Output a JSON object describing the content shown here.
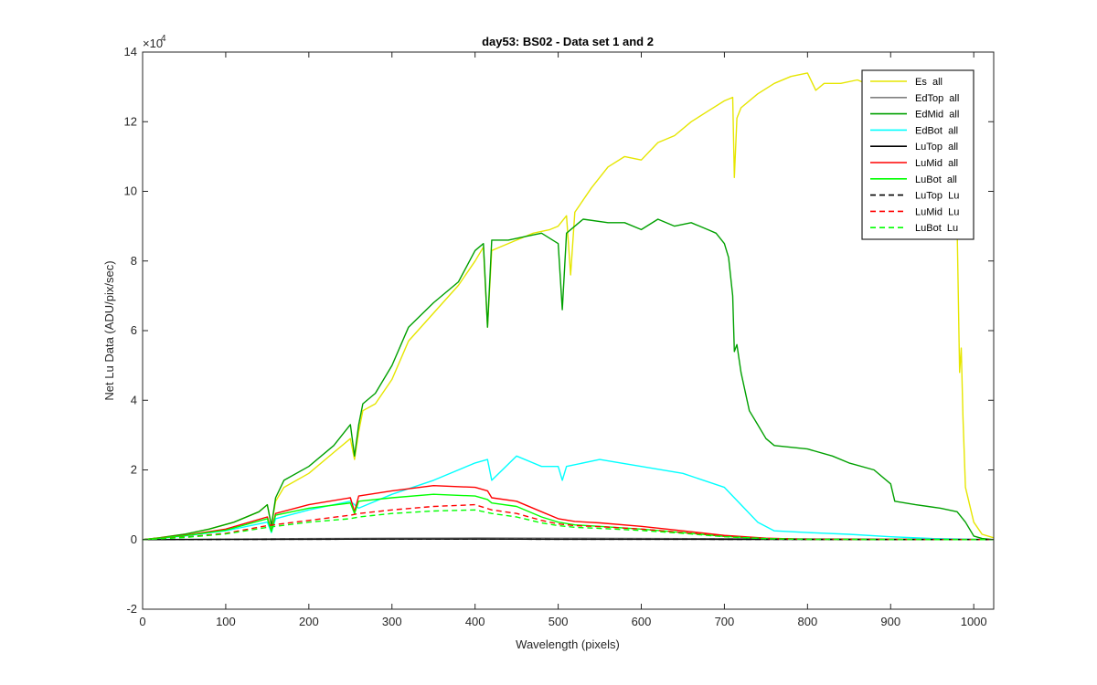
{
  "chart_data": {
    "type": "line",
    "title": "day53: BS02 - Data set 1 and 2",
    "xlabel": "Wavelength (pixels)",
    "ylabel": "Net Lu Data (ADU/pix/sec)",
    "xlim": [
      0,
      1024
    ],
    "ylim": [
      -20000,
      140000
    ],
    "y_exponent_label": "×10",
    "y_exponent_power": "4",
    "xticks": [
      0,
      100,
      200,
      300,
      400,
      500,
      600,
      700,
      800,
      900,
      1000
    ],
    "xtick_labels": [
      "0",
      "100",
      "200",
      "300",
      "400",
      "500",
      "600",
      "700",
      "800",
      "900",
      "1000"
    ],
    "yticks": [
      -20000,
      0,
      20000,
      40000,
      60000,
      80000,
      100000,
      120000,
      140000
    ],
    "ytick_labels": [
      "-2",
      "0",
      "2",
      "4",
      "6",
      "8",
      "10",
      "12",
      "14"
    ],
    "grid": false,
    "legend_position": "top-right",
    "series": [
      {
        "name": "Es  all",
        "color": "#e6e600",
        "dash": "solid",
        "x": [
          0,
          20,
          50,
          80,
          110,
          140,
          150,
          155,
          160,
          170,
          200,
          230,
          250,
          255,
          260,
          265,
          280,
          300,
          320,
          350,
          380,
          400,
          410,
          415,
          420,
          430,
          450,
          470,
          490,
          500,
          510,
          515,
          520,
          540,
          560,
          580,
          600,
          620,
          640,
          660,
          680,
          700,
          710,
          712,
          715,
          720,
          740,
          760,
          780,
          800,
          810,
          820,
          840,
          860,
          880,
          900,
          920,
          940,
          960,
          980,
          983,
          985,
          987,
          990,
          1000,
          1010,
          1024
        ],
        "y": [
          0,
          500,
          1500,
          3000,
          5000,
          8000,
          10000,
          4000,
          11000,
          15000,
          19000,
          25000,
          29000,
          23000,
          31000,
          37000,
          39000,
          46000,
          57000,
          65000,
          73000,
          80000,
          84000,
          61000,
          83000,
          84000,
          86000,
          88000,
          89000,
          90000,
          93000,
          76000,
          94000,
          101000,
          107000,
          110000,
          109000,
          114000,
          116000,
          120000,
          123000,
          126000,
          127000,
          104000,
          121000,
          124000,
          128000,
          131000,
          133000,
          134000,
          129000,
          131000,
          131000,
          132000,
          130000,
          130000,
          129000,
          127000,
          120000,
          90000,
          48000,
          55000,
          35000,
          15000,
          5000,
          1500,
          500
        ]
      },
      {
        "name": "EdTop  all",
        "color": "#808080",
        "dash": "solid",
        "x": [
          0,
          100,
          200,
          300,
          400,
          500,
          600,
          700,
          800,
          900,
          1000,
          1024
        ],
        "y": [
          0,
          150,
          300,
          400,
          450,
          400,
          350,
          250,
          200,
          150,
          80,
          0
        ]
      },
      {
        "name": "EdMid  all",
        "color": "#00a000",
        "dash": "solid",
        "x": [
          0,
          20,
          50,
          80,
          110,
          140,
          150,
          155,
          160,
          170,
          200,
          230,
          250,
          255,
          260,
          265,
          280,
          300,
          320,
          350,
          380,
          400,
          410,
          415,
          420,
          440,
          460,
          480,
          500,
          505,
          510,
          530,
          560,
          580,
          600,
          620,
          640,
          660,
          680,
          690,
          700,
          705,
          710,
          712,
          715,
          720,
          730,
          740,
          750,
          760,
          800,
          830,
          850,
          880,
          900,
          905,
          930,
          960,
          980,
          990,
          1000,
          1010,
          1024
        ],
        "y": [
          0,
          500,
          1500,
          3000,
          5000,
          8000,
          10000,
          4000,
          12000,
          17000,
          21000,
          27000,
          33000,
          24000,
          33000,
          39000,
          42000,
          50000,
          61000,
          68000,
          74000,
          83000,
          85000,
          61000,
          86000,
          86000,
          87000,
          88000,
          85000,
          66000,
          88000,
          92000,
          91000,
          91000,
          89000,
          92000,
          90000,
          91000,
          89000,
          88000,
          85000,
          81000,
          70000,
          54000,
          56000,
          48000,
          37000,
          33000,
          29000,
          27000,
          26000,
          24000,
          22000,
          20000,
          16000,
          11000,
          10000,
          9000,
          8000,
          5000,
          1000,
          300,
          0
        ]
      },
      {
        "name": "EdBot  all",
        "color": "#00ffff",
        "dash": "solid",
        "x": [
          0,
          50,
          100,
          150,
          155,
          160,
          200,
          250,
          260,
          300,
          350,
          400,
          415,
          420,
          450,
          480,
          500,
          505,
          510,
          550,
          600,
          650,
          700,
          720,
          740,
          760,
          800,
          850,
          900,
          950,
          1000,
          1024
        ],
        "y": [
          0,
          1000,
          2500,
          5000,
          2000,
          6000,
          8500,
          11000,
          9000,
          13000,
          17000,
          22000,
          23000,
          17000,
          24000,
          21000,
          21000,
          17000,
          21000,
          23000,
          21000,
          19000,
          15000,
          10000,
          5000,
          2500,
          2000,
          1500,
          800,
          300,
          100,
          0
        ]
      },
      {
        "name": "LuTop  all",
        "color": "#000000",
        "dash": "solid",
        "x": [
          0,
          100,
          200,
          300,
          400,
          500,
          600,
          700,
          800,
          900,
          1000,
          1024
        ],
        "y": [
          0,
          50,
          100,
          150,
          150,
          100,
          80,
          60,
          40,
          20,
          10,
          0
        ]
      },
      {
        "name": "LuMid  all",
        "color": "#ff0000",
        "dash": "solid",
        "x": [
          0,
          50,
          100,
          150,
          155,
          160,
          200,
          250,
          255,
          260,
          300,
          350,
          400,
          415,
          420,
          450,
          480,
          500,
          520,
          550,
          600,
          650,
          700,
          750,
          800,
          900,
          1000,
          1024
        ],
        "y": [
          0,
          1200,
          3000,
          6500,
          2500,
          7500,
          10000,
          12000,
          8000,
          12500,
          14000,
          15500,
          15000,
          14000,
          12000,
          11000,
          8000,
          6000,
          5200,
          4800,
          3800,
          2500,
          1200,
          400,
          100,
          50,
          20,
          0
        ]
      },
      {
        "name": "LuBot  all",
        "color": "#00ff00",
        "dash": "solid",
        "x": [
          0,
          50,
          100,
          150,
          155,
          160,
          200,
          250,
          255,
          260,
          300,
          350,
          400,
          415,
          420,
          450,
          480,
          500,
          520,
          550,
          600,
          650,
          700,
          750,
          800,
          900,
          1000,
          1024
        ],
        "y": [
          0,
          1100,
          2700,
          6000,
          2300,
          7000,
          9000,
          10500,
          7500,
          11000,
          12000,
          13000,
          12500,
          11500,
          10500,
          9500,
          6500,
          5000,
          4200,
          3800,
          3000,
          2000,
          900,
          300,
          80,
          40,
          10,
          0
        ]
      },
      {
        "name": "LuTop  Lu",
        "color": "#000000",
        "dash": "dashed",
        "x": [
          0,
          100,
          200,
          300,
          400,
          500,
          600,
          700,
          800,
          900,
          1000,
          1024
        ],
        "y": [
          0,
          50,
          100,
          120,
          120,
          100,
          80,
          60,
          40,
          20,
          10,
          0
        ]
      },
      {
        "name": "LuMid  Lu",
        "color": "#ff0000",
        "dash": "dashed",
        "x": [
          0,
          50,
          100,
          150,
          200,
          250,
          260,
          300,
          350,
          400,
          420,
          450,
          480,
          500,
          520,
          550,
          600,
          650,
          700,
          750,
          800,
          900,
          1024
        ],
        "y": [
          0,
          700,
          1800,
          4000,
          5500,
          7000,
          7500,
          8500,
          9500,
          10000,
          8500,
          7500,
          5500,
          4500,
          4000,
          3700,
          3000,
          2000,
          1000,
          300,
          80,
          30,
          0
        ]
      },
      {
        "name": "LuBot  Lu",
        "color": "#00ff00",
        "dash": "dashed",
        "x": [
          0,
          50,
          100,
          150,
          200,
          250,
          260,
          300,
          350,
          400,
          420,
          450,
          480,
          500,
          520,
          550,
          600,
          650,
          700,
          750,
          800,
          900,
          1024
        ],
        "y": [
          0,
          600,
          1600,
          3500,
          5000,
          6000,
          6500,
          7500,
          8200,
          8500,
          7500,
          6500,
          4800,
          4000,
          3500,
          3200,
          2600,
          1800,
          800,
          250,
          60,
          20,
          0
        ]
      }
    ]
  }
}
